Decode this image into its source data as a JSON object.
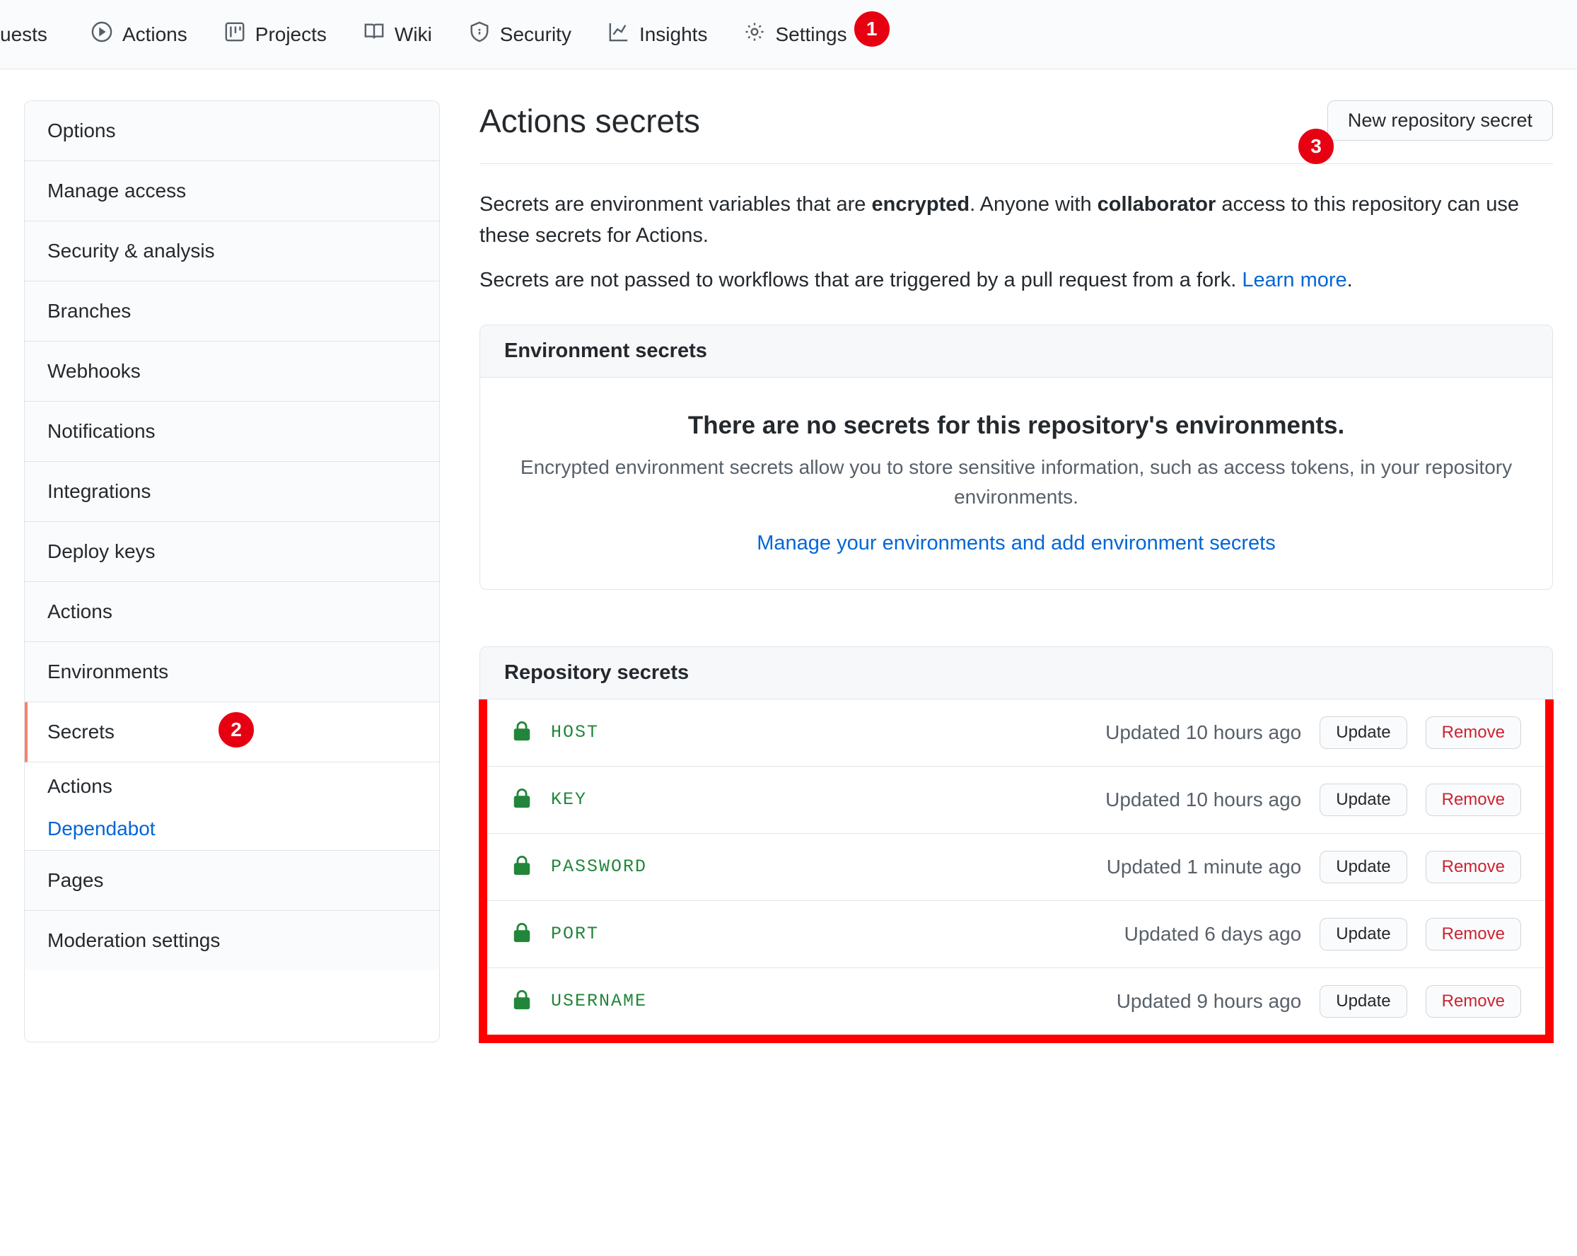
{
  "topnav": {
    "cutoff": "uests",
    "items": [
      {
        "label": "Actions"
      },
      {
        "label": "Projects"
      },
      {
        "label": "Wiki"
      },
      {
        "label": "Security"
      },
      {
        "label": "Insights"
      },
      {
        "label": "Settings"
      }
    ]
  },
  "circles": {
    "c1": "1",
    "c2": "2",
    "c3": "3"
  },
  "sidebar": {
    "items": [
      {
        "label": "Options"
      },
      {
        "label": "Manage access"
      },
      {
        "label": "Security & analysis"
      },
      {
        "label": "Branches"
      },
      {
        "label": "Webhooks"
      },
      {
        "label": "Notifications"
      },
      {
        "label": "Integrations"
      },
      {
        "label": "Deploy keys"
      },
      {
        "label": "Actions"
      },
      {
        "label": "Environments"
      },
      {
        "label": "Secrets"
      }
    ],
    "sub": {
      "main": "Actions",
      "link": "Dependabot"
    },
    "items2": [
      {
        "label": "Pages"
      },
      {
        "label": "Moderation settings"
      }
    ]
  },
  "main": {
    "title": "Actions secrets",
    "new_secret_btn": "New repository secret",
    "desc1_pre": "Secrets are environment variables that are ",
    "desc1_strong1": "encrypted",
    "desc1_mid": ". Anyone with ",
    "desc1_strong2": "collaborator",
    "desc1_post": " access to this repository can use these secrets for Actions.",
    "desc2_pre": "Secrets are not passed to workflows that are triggered by a pull request from a fork. ",
    "learn_more": "Learn more",
    "desc2_post": "."
  },
  "env_box": {
    "header": "Environment secrets",
    "empty_title": "There are no secrets for this repository's environments.",
    "empty_desc": "Encrypted environment secrets allow you to store sensitive information, such as access tokens, in your repository environments.",
    "link": "Manage your environments and add environment secrets"
  },
  "repo_box": {
    "header": "Repository secrets",
    "update_label": "Update",
    "remove_label": "Remove",
    "secrets": [
      {
        "name": "HOST",
        "updated": "Updated 10 hours ago"
      },
      {
        "name": "KEY",
        "updated": "Updated 10 hours ago"
      },
      {
        "name": "PASSWORD",
        "updated": "Updated 1 minute ago"
      },
      {
        "name": "PORT",
        "updated": "Updated 6 days ago"
      },
      {
        "name": "USERNAME",
        "updated": "Updated 9 hours ago"
      }
    ]
  }
}
